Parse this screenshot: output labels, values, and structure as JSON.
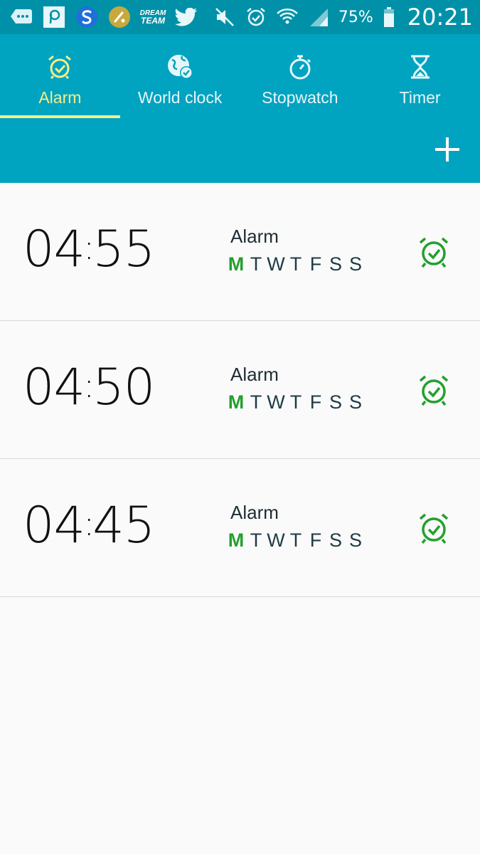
{
  "status_bar": {
    "icons": [
      "message-icon",
      "pinterest-icon",
      "swiftkey-icon",
      "cricket-icon",
      "dream-team-icon",
      "twitter-icon",
      "mute-icon",
      "alarm-icon",
      "wifi-icon",
      "signal-icon",
      "battery-icon"
    ],
    "dream_team_line1": "DREAM",
    "dream_team_line2": "TEAM",
    "battery": "75%",
    "time": "20:21"
  },
  "tabs": [
    {
      "label": "Alarm",
      "icon": "alarm-clock-icon",
      "active": true
    },
    {
      "label": "World clock",
      "icon": "globe-icon",
      "active": false
    },
    {
      "label": "Stopwatch",
      "icon": "stopwatch-icon",
      "active": false
    },
    {
      "label": "Timer",
      "icon": "hourglass-icon",
      "active": false
    }
  ],
  "add_button": {
    "icon": "plus-icon"
  },
  "alarms": [
    {
      "hours": "04",
      "minutes": "55",
      "label": "Alarm",
      "days": [
        "M",
        "T",
        "W",
        "T",
        "F",
        "S",
        "S"
      ],
      "active_days": [
        0
      ],
      "enabled": true
    },
    {
      "hours": "04",
      "minutes": "50",
      "label": "Alarm",
      "days": [
        "M",
        "T",
        "W",
        "T",
        "F",
        "S",
        "S"
      ],
      "active_days": [
        0
      ],
      "enabled": true
    },
    {
      "hours": "04",
      "minutes": "45",
      "label": "Alarm",
      "days": [
        "M",
        "T",
        "W",
        "T",
        "F",
        "S",
        "S"
      ],
      "active_days": [
        0
      ],
      "enabled": true
    }
  ],
  "colors": {
    "status_bar": "#0091a8",
    "app_bar": "#00a3c0",
    "active_tab": "#f3ef8a",
    "active_day": "#23a02e",
    "alarm_on_icon": "#23a02e"
  }
}
